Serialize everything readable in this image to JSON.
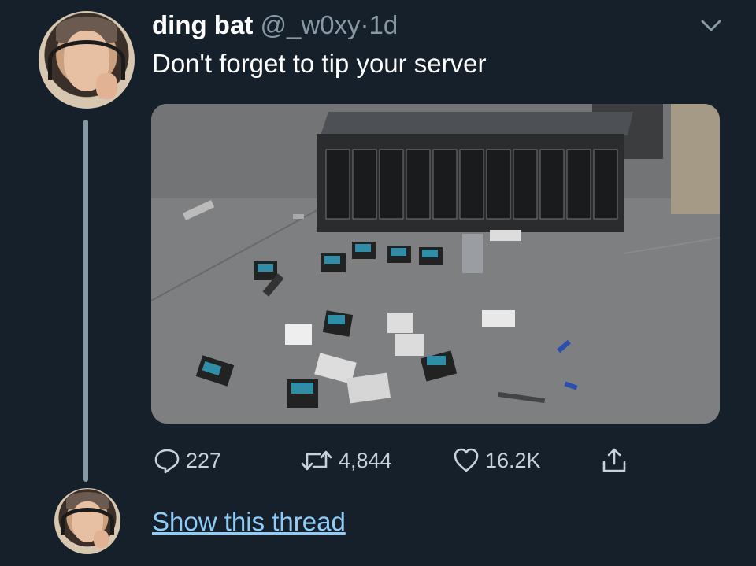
{
  "tweet": {
    "author_name": "ding bat",
    "handle": "@_w0xy",
    "separator": "·",
    "time": "1d",
    "text": "Don't forget to tip your server",
    "media_alt_icon": "photo-smashed-server-hard-drives"
  },
  "actions": {
    "reply_count": "227",
    "retweet_count": "4,844",
    "like_count": "16.2K",
    "reply_icon": "reply-icon",
    "retweet_icon": "retweet-icon",
    "like_icon": "heart-icon",
    "share_icon": "share-icon"
  },
  "thread": {
    "show_label": "Show this thread"
  },
  "colors": {
    "background": "#15202b",
    "muted": "#8899a6",
    "link": "#8ecdf7"
  }
}
